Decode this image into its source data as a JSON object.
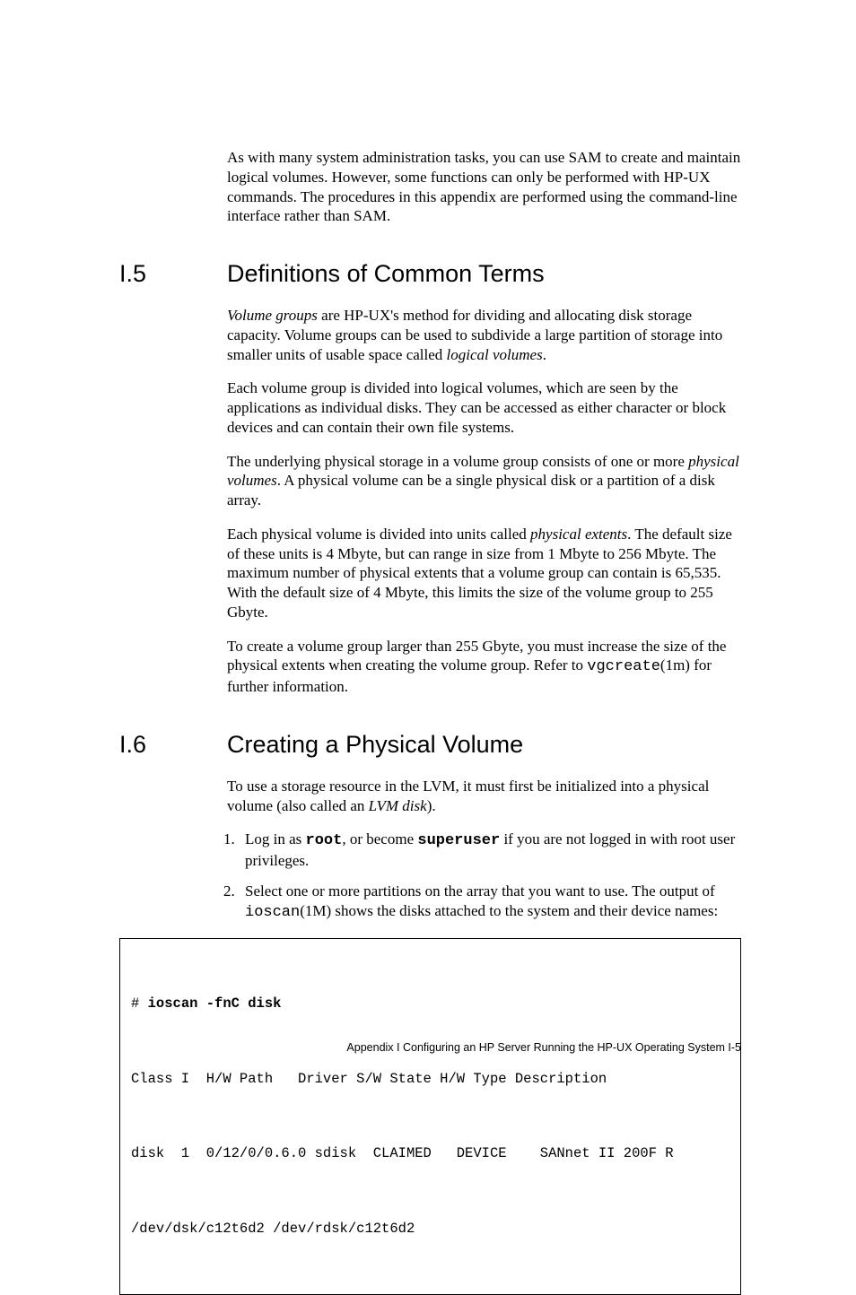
{
  "intro": {
    "p1_a": "As with many system administration tasks, you can use SAM to create and maintain logical volumes. However, some functions can only be performed with HP-UX commands. The procedures in this appendix are performed using the command-line interface rather than SAM."
  },
  "section5": {
    "num": "I.5",
    "title": "Definitions of Common Terms",
    "p1_before": "Volume groups",
    "p1_mid": " are HP-UX's method for dividing and allocating disk storage capacity. Volume groups can be used to subdivide a large partition of storage into smaller units of usable space called ",
    "p1_i2": "logical volumes",
    "p1_after": ".",
    "p2": "Each volume group is divided into logical volumes, which are seen by the applications as individual disks. They can be accessed as either character or block devices and can contain their own file systems.",
    "p3_a": "The underlying physical storage in a volume group consists of one or more ",
    "p3_i": "physical volumes",
    "p3_b": ". A physical volume can be a single physical disk or a partition of a disk array.",
    "p4_a": "Each physical volume is divided into units called ",
    "p4_i": "physical extents",
    "p4_b": ". The default size of these units is 4 Mbyte, but can range in size from 1 Mbyte to 256 Mbyte. The maximum number of physical extents that a volume group can contain is 65,535. With the default size of 4 Mbyte, this limits the size of the volume group to 255 Gbyte.",
    "p5_a": "To create a volume group larger than 255 Gbyte, you must increase the size of the physical extents when creating the volume group. Refer to ",
    "p5_code": "vgcreate",
    "p5_b": "(1m) for further information."
  },
  "section6": {
    "num": "I.6",
    "title": "Creating a Physical Volume",
    "p1_a": "To use a storage resource in the LVM, it must first be initialized into a physical volume (also called an ",
    "p1_i": "LVM disk",
    "p1_b": ").",
    "step1_a": "Log in as ",
    "step1_b1": "root",
    "step1_c": ", or become ",
    "step1_b2": "superuser",
    "step1_d": " if you are not logged in with root user privileges.",
    "step2_a": "Select one or more partitions on the array that you want to use. The output of ",
    "step2_code": "ioscan",
    "step2_b": "(1M) shows the disks attached to the system and their device names:"
  },
  "code": {
    "l1_prompt": "# ",
    "l1_cmd": "ioscan -fnC disk",
    "l2": "Class I  H/W Path   Driver S/W State H/W Type Description",
    "l3": "disk  1  0/12/0/0.6.0 sdisk  CLAIMED   DEVICE    SANnet II 200F R",
    "l4": "/dev/dsk/c12t6d2 /dev/rdsk/c12t6d2"
  },
  "footer": {
    "text": "Appendix  I   Configuring an HP Server Running the HP-UX Operating System I-5"
  }
}
